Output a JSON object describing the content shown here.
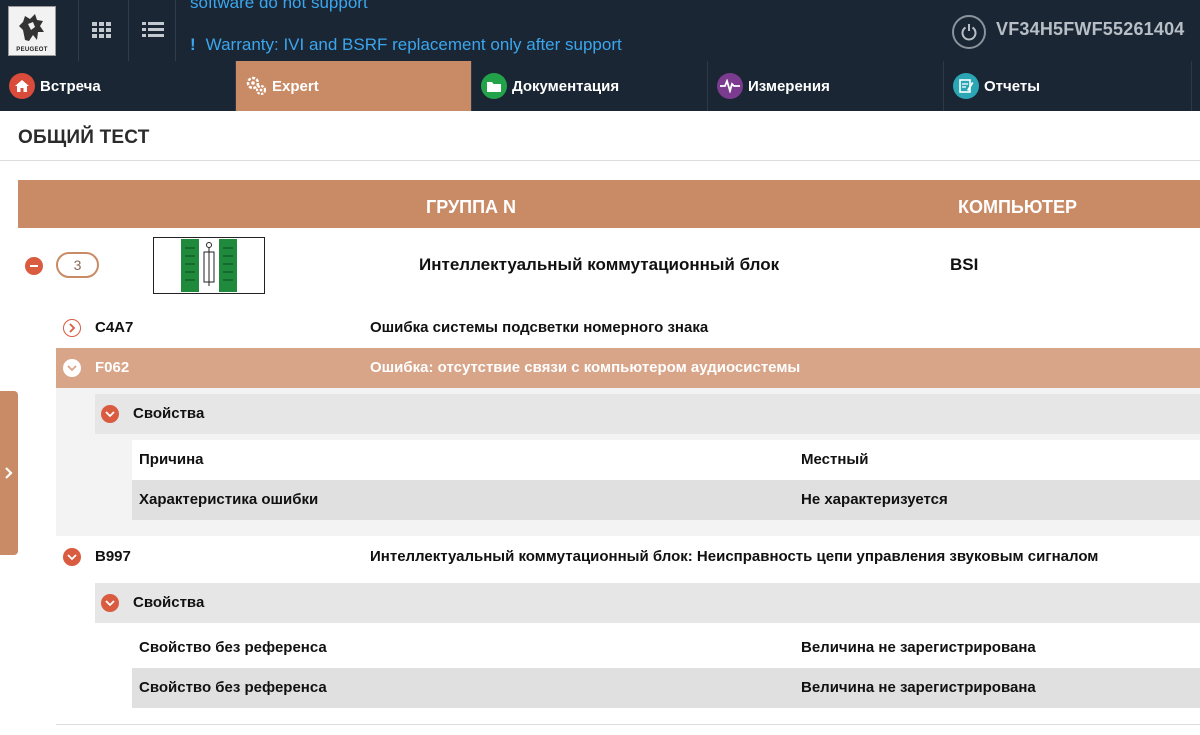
{
  "header": {
    "brand": "PEUGEOT",
    "message_top": "software do not support",
    "message_warning_mark": "!",
    "message_warning": "Warranty: IVI and BSRF replacement only after support",
    "vin": "VF34H5FWF55261404"
  },
  "tabs": [
    {
      "label": "Встреча",
      "icon": "house-icon",
      "color": "#d94b3a"
    },
    {
      "label": "Expert",
      "icon": "gears-icon",
      "active": true
    },
    {
      "label": "Документация",
      "icon": "folder-icon",
      "color": "#22a34a"
    },
    {
      "label": "Измерения",
      "icon": "pulse-icon",
      "color": "#7b3b8f"
    },
    {
      "label": "Отчеты",
      "icon": "report-icon",
      "color": "#2aa6b5"
    }
  ],
  "page": {
    "title": "ОБЩИЙ ТЕСТ"
  },
  "table": {
    "col_group": "ГРУППА N",
    "col_computer": "КОМПЬЮТЕР"
  },
  "group": {
    "count": "3",
    "name": "Интеллектуальный коммутационный блок",
    "ecu": "BSI"
  },
  "faults": [
    {
      "code": "C4A7",
      "description": "Ошибка системы подсветки номерного знака",
      "state": "collapsed"
    },
    {
      "code": "F062",
      "description": "Ошибка: отсутствие связи с компьютером аудиосистемы",
      "state": "expanded-selected",
      "properties_label": "Свойства",
      "properties": [
        {
          "key": "Причина",
          "value": "Местный"
        },
        {
          "key": "Характеристика ошибки",
          "value": "Не характеризуется"
        }
      ]
    },
    {
      "code": "B997",
      "description": "Интеллектуальный коммутационный блок: Неисправность цепи управления звуковым сигналом",
      "state": "expanded",
      "properties_label": "Свойства",
      "properties": [
        {
          "key": "Свойство без референса",
          "value": "Величина не зарегистрирована"
        },
        {
          "key": "Свойство без референса",
          "value": "Величина не зарегистрирована"
        }
      ]
    }
  ],
  "colors": {
    "accent": "#c98a66",
    "selected_row": "#d8a589",
    "header_bg": "#1a2634",
    "badge_red": "#d95b40",
    "link_blue": "#3ba6ee"
  }
}
